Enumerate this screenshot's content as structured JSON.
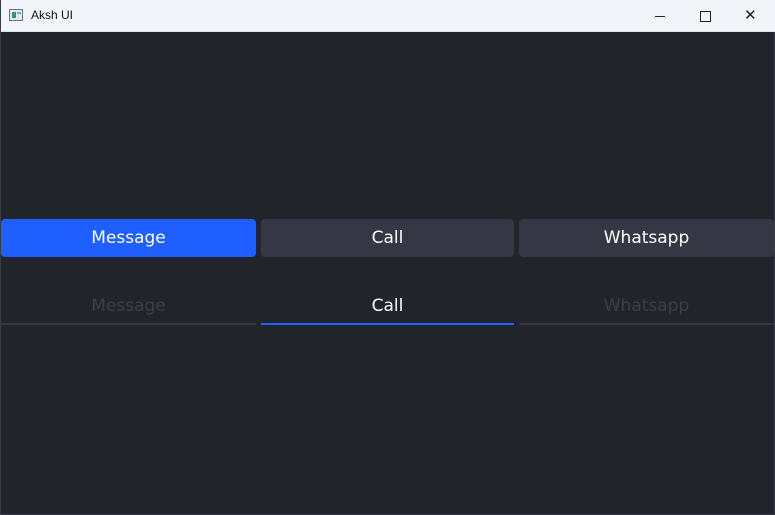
{
  "window": {
    "title": "Aksh UI",
    "close_glyph": "✕"
  },
  "segmented": {
    "items": [
      {
        "label": "Message",
        "state": "active"
      },
      {
        "label": "Call",
        "state": "inactive"
      },
      {
        "label": "Whatsapp",
        "state": "inactive"
      }
    ]
  },
  "tabs": {
    "items": [
      {
        "label": "Message",
        "state": "inactive"
      },
      {
        "label": "Call",
        "state": "active"
      },
      {
        "label": "Whatsapp",
        "state": "inactive"
      }
    ]
  },
  "colors": {
    "background": "#22242b",
    "accent": "#1f5eff",
    "button_inactive": "#353844",
    "tab_inactive_text": "#3b3e47"
  },
  "icons": {
    "app": "app-window-icon",
    "minimize": "minimize-icon",
    "maximize": "maximize-icon",
    "close": "close-icon"
  }
}
